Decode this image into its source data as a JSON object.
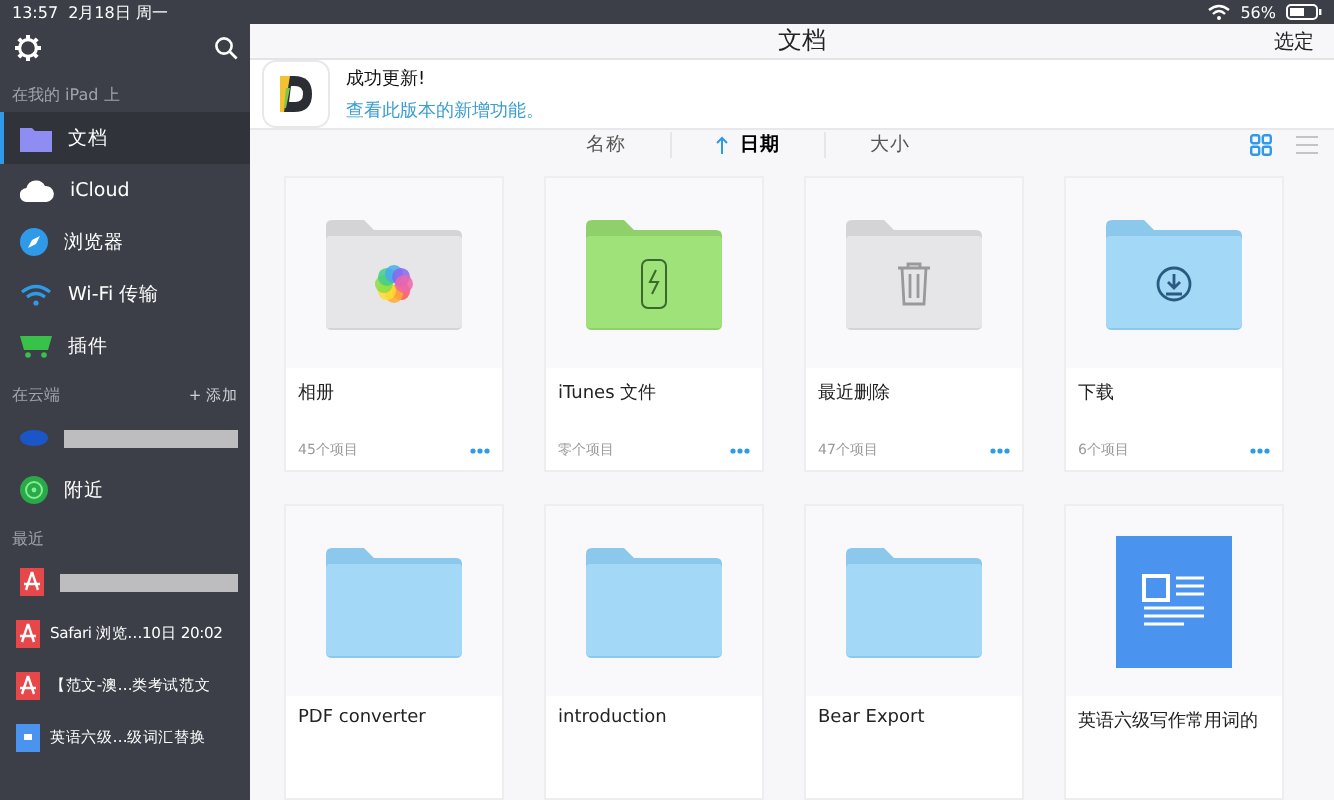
{
  "status_bar": {
    "time": "13:57",
    "date": "2月18日 周一",
    "battery_text": "56%"
  },
  "sidebar": {
    "sections": [
      {
        "title": "在我的 iPad 上",
        "items": [
          {
            "kind": "folder",
            "label": "文档",
            "selected": true
          },
          {
            "kind": "cloud",
            "label": "iCloud",
            "selected": false
          },
          {
            "kind": "compass",
            "label": "浏览器",
            "selected": false
          },
          {
            "kind": "wifi",
            "label": "Wi-Fi 传输",
            "selected": false
          },
          {
            "kind": "cart",
            "label": "插件",
            "selected": false
          }
        ]
      },
      {
        "title": "在云端",
        "action": "+ 添加",
        "items": [
          {
            "kind": "redacted-cloud",
            "selected": false
          },
          {
            "kind": "radar",
            "label": "附近",
            "selected": false
          }
        ]
      },
      {
        "title": "最近",
        "items": [
          {
            "kind": "redacted-pdf",
            "selected": false
          },
          {
            "kind": "pdf",
            "label": "Safari 浏览…10日 20:02",
            "selected": false
          },
          {
            "kind": "pdf",
            "label": "【范文-澳…类考试范文",
            "selected": false
          },
          {
            "kind": "doc",
            "label": "英语六级…级词汇替换",
            "selected": false
          }
        ]
      }
    ]
  },
  "header": {
    "title": "文档",
    "action": "选定"
  },
  "banner": {
    "title": "成功更新!",
    "link": "查看此版本的新增功能。"
  },
  "sort": [
    {
      "label": "名称",
      "selected": false
    },
    {
      "label": "日期",
      "selected": true
    },
    {
      "label": "大小",
      "selected": false
    }
  ],
  "view_modes": [
    {
      "kind": "grid",
      "selected": true
    },
    {
      "kind": "list",
      "selected": false
    }
  ],
  "files": [
    {
      "kind": "photos",
      "name": "相册",
      "meta": "45个项目"
    },
    {
      "kind": "itunes",
      "name": "iTunes 文件",
      "meta": "零个项目"
    },
    {
      "kind": "trash",
      "name": "最近删除",
      "meta": "47个项目"
    },
    {
      "kind": "download",
      "name": "下载",
      "meta": "6个项目"
    },
    {
      "kind": "folder",
      "name": "PDF converter"
    },
    {
      "kind": "folder",
      "name": "introduction"
    },
    {
      "kind": "folder",
      "name": "Bear Export"
    },
    {
      "kind": "document",
      "name": "英语六级写作常用词的"
    }
  ]
}
